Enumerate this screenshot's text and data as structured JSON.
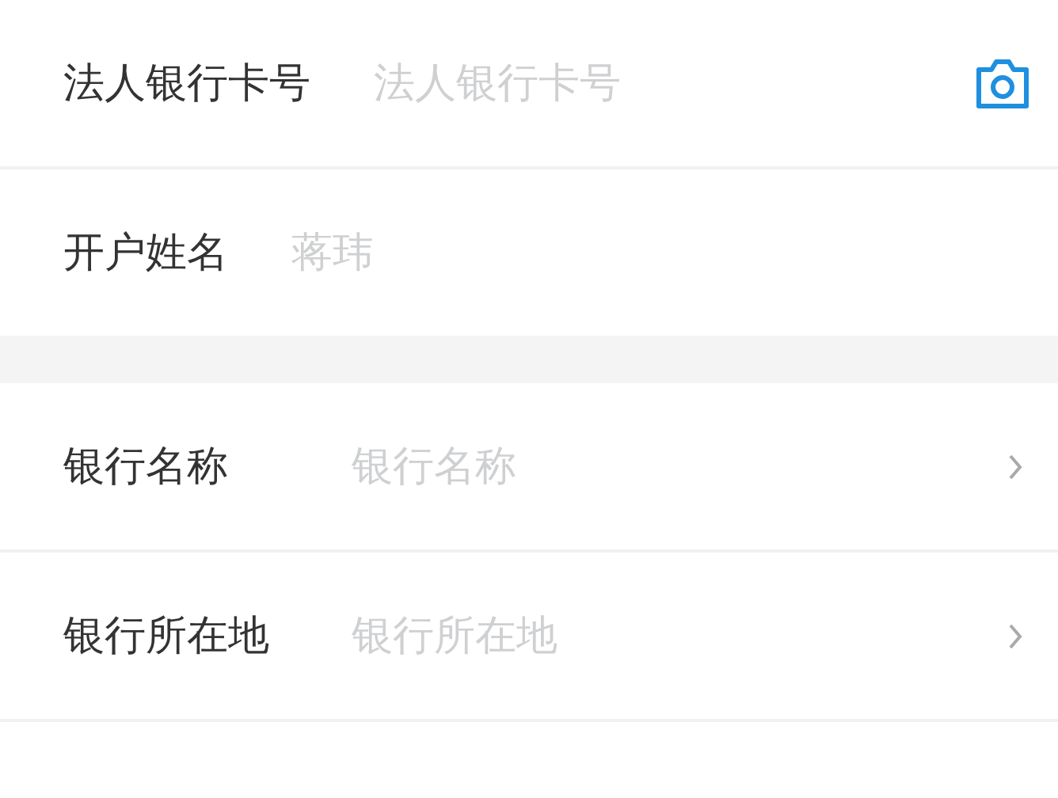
{
  "sections": [
    {
      "rows": [
        {
          "kind": "scan",
          "label": "法人银行卡号",
          "placeholder": "法人银行卡号"
        },
        {
          "kind": "input",
          "label": "开户姓名",
          "placeholder": "蒋玮"
        }
      ]
    },
    {
      "rows": [
        {
          "kind": "select",
          "label": "银行名称",
          "placeholder": "银行名称"
        },
        {
          "kind": "select",
          "label": "银行所在地",
          "placeholder": "银行所在地"
        }
      ]
    }
  ]
}
